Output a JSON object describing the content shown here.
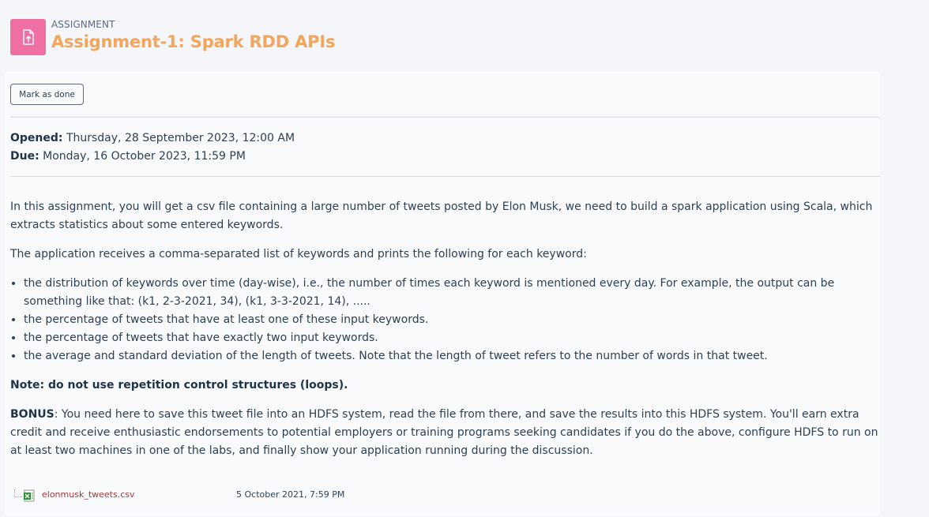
{
  "header": {
    "activity_type": "ASSIGNMENT",
    "title": "Assignment-1: Spark RDD APIs",
    "icon": "assignment-upload-icon",
    "icon_color": "#ef6fa4",
    "title_color": "#f3a55d"
  },
  "completion": {
    "mark_done_label": "Mark as done"
  },
  "dates": {
    "opened_label": "Opened:",
    "opened_value": " Thursday, 28 September 2023, 12:00 AM",
    "due_label": "Due:",
    "due_value": " Monday, 16 October 2023, 11:59 PM"
  },
  "description": {
    "intro": "In this assignment, you will get a csv file containing a large number of tweets posted by Elon Musk, we need to build a spark application using Scala, which extracts statistics about some entered keywords.",
    "receives": "The application receives a comma-separated list of keywords and prints the following for each keyword:",
    "bullets": [
      "the distribution of keywords over time (day-wise), i.e., the number of times each keyword is mentioned every day. For example, the output can be something like that: (k1, 2-3-2021, 34), (k1, 3-3-2021, 14), .....",
      "the percentage of tweets that have at least one of these input keywords.",
      "the percentage of tweets that have exactly two input keywords.",
      "the average and standard deviation of the length of tweets. Note that the length of tweet refers to the number of words in that tweet."
    ],
    "note": "Note: do not use repetition control structures (loops).",
    "bonus_label": "BONUS",
    "bonus_text": ": You need here to save this tweet file into an HDFS system, read the file from there, and save the results into this HDFS system. You'll earn extra credit and receive enthusiastic endorsements to potential employers or training programs seeking candidates if you do the above, configure HDFS to run on at least two machines in one of the labs, and finally show your application running during the discussion."
  },
  "files": [
    {
      "name": "elonmusk_tweets.csv",
      "date": "5 October 2021, 7:59 PM",
      "icon": "spreadsheet-file-icon"
    }
  ]
}
